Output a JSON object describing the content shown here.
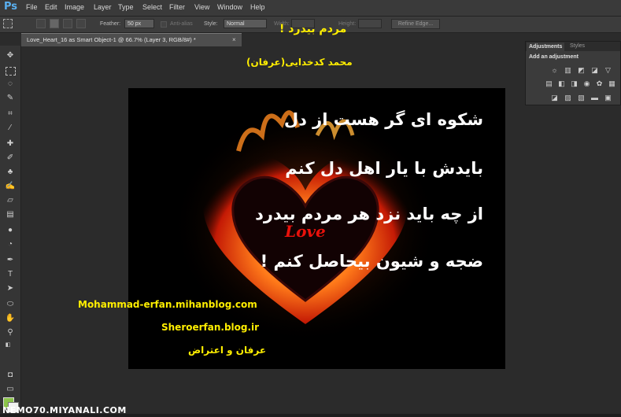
{
  "app": {
    "logo": "Ps"
  },
  "menus": [
    "File",
    "Edit",
    "Image",
    "Layer",
    "Type",
    "Select",
    "Filter",
    "View",
    "Window",
    "Help"
  ],
  "options": {
    "feather_label": "Feather:",
    "feather_value": "50 px",
    "antialias_label": "Anti-alias",
    "style_label": "Style:",
    "style_value": "Normal",
    "width_label": "Width:",
    "height_label": "Height:",
    "refine_label": "Refine Edge..."
  },
  "document": {
    "tab_title": "Love_Heart_16 as Smart Object-1 @ 66.7% (Layer 3, RGB/8#) *",
    "close": "×"
  },
  "overlay": {
    "top_title": "مردم بیدرد !",
    "author": "محمد کدخدایی(عرفان)"
  },
  "canvas": {
    "poem": [
      "شکوه ای گر هست از دل",
      "بایدش با یار اهل دل کنم",
      "از چه باید نزد هر مردم بیدرد",
      "ضجه و شیون بیحاصل کنم !"
    ],
    "heart_text": "Love",
    "website1": "Mohammad-erfan.mihanblog.com",
    "website2": "Sheroerfan.blog.ir",
    "signature": "عرفان و اعتراض"
  },
  "adjustments_panel": {
    "tab_active": "Adjustments",
    "tab_other": "Styles",
    "heading": "Add an adjustment"
  },
  "footer": {
    "watermark": "NEMO70.MIYANALI.COM"
  },
  "colors": {
    "foreground": "#8bc34a",
    "background": "#f2f2f2",
    "overlay_text": "#ffee00"
  }
}
